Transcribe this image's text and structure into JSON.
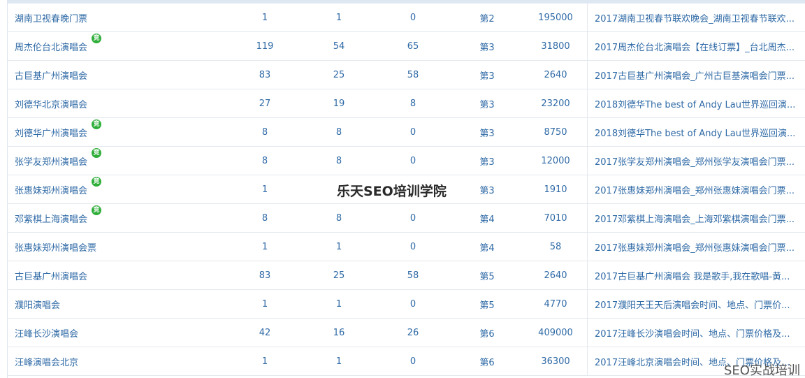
{
  "rows": [
    {
      "keyword": "湖南卫视春晚门票",
      "badge": "",
      "c1": "1",
      "c2": "1",
      "c3": "0",
      "rank": "第2",
      "volume": "195000",
      "title": "2017湖南卫视春节联欢晚会_湖南卫视春节联欢..."
    },
    {
      "keyword": "周杰伦台北演唱会",
      "badge": "竞",
      "c1": "119",
      "c2": "54",
      "c3": "65",
      "rank": "第3",
      "volume": "31800",
      "title": "2017周杰伦台北演唱会【在线订票】_台北周杰..."
    },
    {
      "keyword": "古巨基广州演唱会",
      "badge": "",
      "c1": "83",
      "c2": "25",
      "c3": "58",
      "rank": "第3",
      "volume": "2640",
      "title": "2017古巨基广州演唱会_广州古巨基演唱会门票..."
    },
    {
      "keyword": "刘德华北京演唱会",
      "badge": "",
      "c1": "27",
      "c2": "19",
      "c3": "8",
      "rank": "第3",
      "volume": "23200",
      "title": "2018刘德华The best of Andy Lau世界巡回演..."
    },
    {
      "keyword": "刘德华广州演唱会",
      "badge": "竞",
      "c1": "8",
      "c2": "8",
      "c3": "0",
      "rank": "第3",
      "volume": "8750",
      "title": "2018刘德华The best of Andy Lau世界巡回演..."
    },
    {
      "keyword": "张学友郑州演唱会",
      "badge": "竞",
      "c1": "8",
      "c2": "8",
      "c3": "0",
      "rank": "第3",
      "volume": "12000",
      "title": "2017张学友郑州演唱会_郑州张学友演唱会门票..."
    },
    {
      "keyword": "张惠妹郑州演唱会",
      "badge": "竞",
      "c1": "1",
      "c2": "",
      "c3": "",
      "rank": "第3",
      "volume": "1910",
      "title": "2017张惠妹郑州演唱会_郑州张惠妹演唱会门票..."
    },
    {
      "keyword": "邓紫棋上海演唱会",
      "badge": "竞",
      "c1": "8",
      "c2": "8",
      "c3": "0",
      "rank": "第4",
      "volume": "7010",
      "title": "2017邓紫棋上海演唱会_上海邓紫棋演唱会门票..."
    },
    {
      "keyword": "张惠妹郑州演唱会票",
      "badge": "",
      "c1": "1",
      "c2": "1",
      "c3": "0",
      "rank": "第4",
      "volume": "58",
      "title": "2017张惠妹郑州演唱会_郑州张惠妹演唱会门票..."
    },
    {
      "keyword": "古巨基广州演唱会",
      "badge": "",
      "c1": "83",
      "c2": "25",
      "c3": "58",
      "rank": "第5",
      "volume": "2640",
      "title": "2017古巨基广州演唱会 我是歌手,我在歌唱-黄..."
    },
    {
      "keyword": "濮阳演唱会",
      "badge": "",
      "c1": "1",
      "c2": "1",
      "c3": "0",
      "rank": "第5",
      "volume": "4770",
      "title": "2017濮阳天王天后演唱会时间、地点、门票价..."
    },
    {
      "keyword": "汪峰长沙演唱会",
      "badge": "",
      "c1": "42",
      "c2": "16",
      "c3": "26",
      "rank": "第6",
      "volume": "409000",
      "title": "2017汪峰长沙演唱会时间、地点、门票价格及..."
    },
    {
      "keyword": "汪峰演唱会北京",
      "badge": "",
      "c1": "1",
      "c2": "1",
      "c3": "0",
      "rank": "第6",
      "volume": "36300",
      "title": "2017汪峰北京演唱会时间、地点、门票价格及..."
    }
  ],
  "watermark_center": "乐天SEO培训学院",
  "watermark_corner": "SEO实战培训",
  "colors": {
    "link": "#2f6aa6",
    "badge": "#2fae3a",
    "border": "#e3e8ee",
    "header_strip": "#dde8f3"
  }
}
